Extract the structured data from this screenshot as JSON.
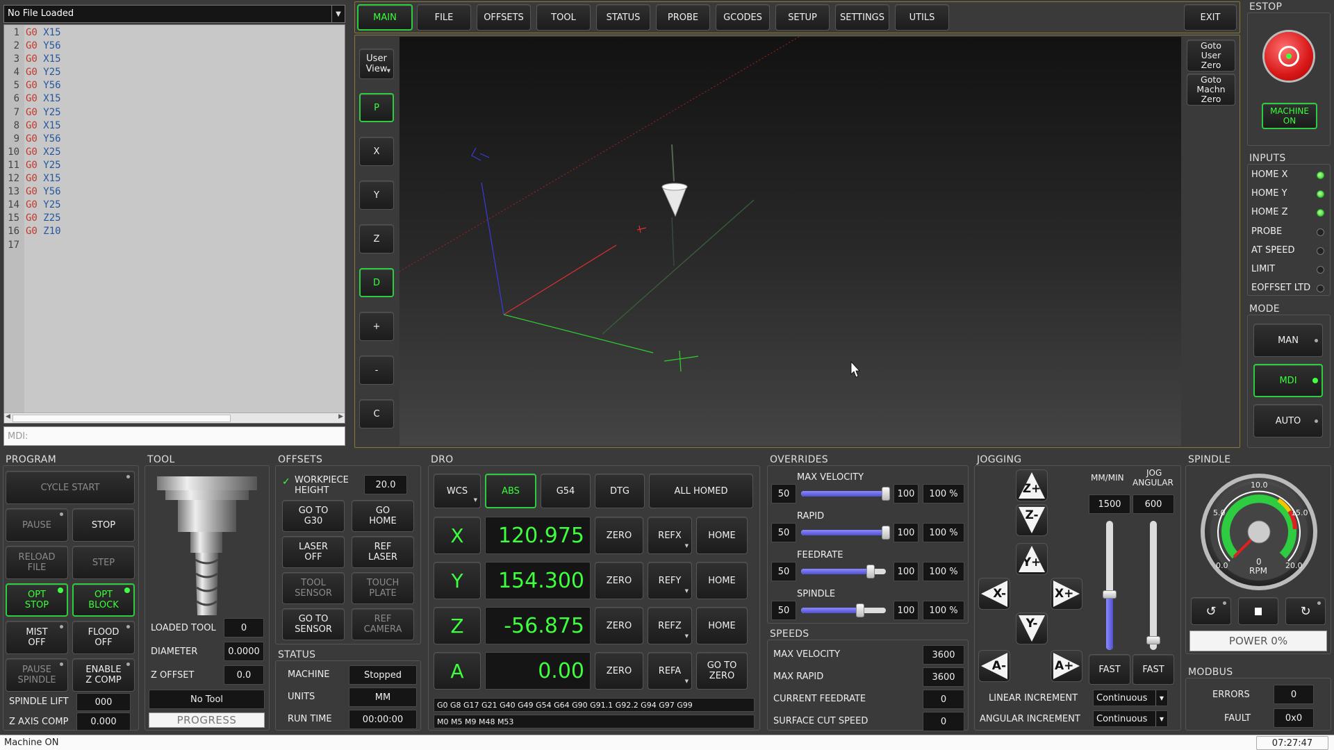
{
  "file": {
    "name": "No File Loaded"
  },
  "gcode": [
    {
      "n": "1",
      "cmd": "G0",
      "axis": "X15"
    },
    {
      "n": "2",
      "cmd": "G0",
      "axis": "Y56"
    },
    {
      "n": "3",
      "cmd": "G0",
      "axis": "X15"
    },
    {
      "n": "4",
      "cmd": "G0",
      "axis": "Y25"
    },
    {
      "n": "5",
      "cmd": "G0",
      "axis": "Y56"
    },
    {
      "n": "6",
      "cmd": "G0",
      "axis": "X15"
    },
    {
      "n": "7",
      "cmd": "G0",
      "axis": "Y25"
    },
    {
      "n": "8",
      "cmd": "G0",
      "axis": "X15"
    },
    {
      "n": "9",
      "cmd": "G0",
      "axis": "Y56"
    },
    {
      "n": "10",
      "cmd": "G0",
      "axis": "X25"
    },
    {
      "n": "11",
      "cmd": "G0",
      "axis": "Y25"
    },
    {
      "n": "12",
      "cmd": "G0",
      "axis": "X15"
    },
    {
      "n": "13",
      "cmd": "G0",
      "axis": "Y56"
    },
    {
      "n": "14",
      "cmd": "G0",
      "axis": "Y25"
    },
    {
      "n": "15",
      "cmd": "G0",
      "axis": "Z25"
    },
    {
      "n": "16",
      "cmd": "G0",
      "axis": "Z10"
    },
    {
      "n": "17",
      "cmd": "",
      "axis": ""
    }
  ],
  "mdi": {
    "placeholder": "MDI:"
  },
  "tabs": {
    "main": "MAIN",
    "file": "FILE",
    "offsets": "OFFSETS",
    "tool": "TOOL",
    "status": "STATUS",
    "probe": "PROBE",
    "gcodes": "GCODES",
    "setup": "SETUP",
    "settings": "SETTINGS",
    "utils": "UTILS",
    "exit": "EXIT"
  },
  "view": {
    "user1": "User",
    "user2": "View",
    "p": "P",
    "x": "X",
    "y": "Y",
    "z": "Z",
    "d": "D",
    "plus": "+",
    "minus": "-",
    "c": "C",
    "goto_user": [
      "Goto",
      "User",
      "Zero"
    ],
    "goto_machine": [
      "Goto",
      "Machn",
      "Zero"
    ]
  },
  "estop": {
    "title": "ESTOP",
    "machine_on": [
      "MACHINE",
      "ON"
    ]
  },
  "inputs": {
    "title": "INPUTS",
    "items": [
      {
        "label": "HOME X",
        "on": true
      },
      {
        "label": "HOME Y",
        "on": true
      },
      {
        "label": "HOME Z",
        "on": true
      },
      {
        "label": "PROBE",
        "on": false
      },
      {
        "label": "AT SPEED",
        "on": false
      },
      {
        "label": "LIMIT",
        "on": false
      },
      {
        "label": "EOFFSET LTD",
        "on": false
      }
    ]
  },
  "mode": {
    "title": "MODE",
    "man": "MAN",
    "mdi": "MDI",
    "auto": "AUTO"
  },
  "program": {
    "title": "PROGRAM",
    "cycle_start": "CYCLE START",
    "pause": "PAUSE",
    "stop": "STOP",
    "reload": [
      "RELOAD",
      "FILE"
    ],
    "step": "STEP",
    "opt_stop": [
      "OPT",
      "STOP"
    ],
    "opt_block": [
      "OPT",
      "BLOCK"
    ],
    "mist": [
      "MIST",
      "OFF"
    ],
    "flood": [
      "FLOOD",
      "OFF"
    ],
    "pause_spindle": [
      "PAUSE",
      "SPINDLE"
    ],
    "enable_zcomp": [
      "ENABLE",
      "Z COMP"
    ],
    "spindle_lift_label": "SPINDLE LIFT",
    "spindle_lift": "000",
    "zcomp_label": "Z AXIS COMP",
    "zcomp": "0.000"
  },
  "tool": {
    "title": "TOOL",
    "loaded_label": "LOADED TOOL",
    "loaded": "0",
    "diameter_label": "DIAMETER",
    "diameter": "0.0000",
    "zoffset_label": "Z OFFSET",
    "zoffset": "0.0",
    "name": "No Tool",
    "progress": "PROGRESS"
  },
  "offsets": {
    "title": "OFFSETS",
    "workpiece": [
      "WORKPIECE",
      "HEIGHT"
    ],
    "workpiece_val": "20.0",
    "goto_g30": [
      "GO TO",
      "G30"
    ],
    "go_home": [
      "GO",
      "HOME"
    ],
    "laser_off": [
      "LASER",
      "OFF"
    ],
    "ref_laser": [
      "REF",
      "LASER"
    ],
    "tool_sensor": [
      "TOOL",
      "SENSOR"
    ],
    "touch_plate": [
      "TOUCH",
      "PLATE"
    ],
    "goto_sensor": [
      "GO TO",
      "SENSOR"
    ],
    "ref_camera": [
      "REF",
      "CAMERA"
    ]
  },
  "status": {
    "title": "STATUS",
    "machine_label": "MACHINE",
    "machine": "Stopped",
    "units_label": "UNITS",
    "units": "MM",
    "runtime_label": "RUN TIME",
    "runtime": "00:00:00"
  },
  "dro": {
    "title": "DRO",
    "wcs": "WCS",
    "abs": "ABS",
    "g54": "G54",
    "dtg": "DTG",
    "all_homed": "ALL HOMED",
    "axes": [
      {
        "axis": "X",
        "value": "120.975",
        "zero": "ZERO",
        "ref": "REFX",
        "home": [
          "HOME"
        ]
      },
      {
        "axis": "Y",
        "value": "154.300",
        "zero": "ZERO",
        "ref": "REFY",
        "home": [
          "HOME"
        ]
      },
      {
        "axis": "Z",
        "value": "-56.875",
        "zero": "ZERO",
        "ref": "REFZ",
        "home": [
          "HOME"
        ]
      },
      {
        "axis": "A",
        "value": "0.00",
        "zero": "ZERO",
        "ref": "REFA",
        "home": [
          "GO TO",
          "ZERO"
        ]
      }
    ],
    "gcodes_active": "G0 G8 G17 G21 G40 G49 G54 G64 G90 G91.1 G92.2 G94 G97 G99",
    "mcodes_active": "M0 M5 M9 M48 M53"
  },
  "overrides": {
    "title": "OVERRIDES",
    "items": [
      {
        "label": "MAX VELOCITY",
        "min": "50",
        "max": "100",
        "value": "100 %",
        "level": 1.0
      },
      {
        "label": "RAPID",
        "min": "50",
        "max": "100",
        "value": "100 %",
        "level": 1.0
      },
      {
        "label": "FEEDRATE",
        "min": "50",
        "max": "100",
        "value": "100 %",
        "level": 0.82
      },
      {
        "label": "SPINDLE",
        "min": "50",
        "max": "100",
        "value": "100 %",
        "level": 0.7
      }
    ]
  },
  "speeds": {
    "title": "SPEEDS",
    "items": [
      {
        "label": "MAX VELOCITY",
        "value": "3600"
      },
      {
        "label": "MAX RAPID",
        "value": "3600"
      },
      {
        "label": "CURRENT FEEDRATE",
        "value": "0"
      },
      {
        "label": "SURFACE CUT SPEED",
        "value": "0"
      }
    ]
  },
  "jogging": {
    "title": "JOGGING",
    "mmmin": "MM/MIN",
    "jog_angular": [
      "JOG",
      "ANGULAR"
    ],
    "linear_rate": "1500",
    "angular_rate": "600",
    "zp": "Z+",
    "zm": "Z-",
    "yp": "Y+",
    "ym": "Y-",
    "xm": "X-",
    "xp": "X+",
    "am": "A-",
    "ap": "A+",
    "fast1": "FAST",
    "fast2": "FAST",
    "linear_inc_label": "LINEAR INCREMENT",
    "linear_inc": "Continuous",
    "angular_inc_label": "ANGULAR INCREMENT",
    "angular_inc": "Continuous"
  },
  "spindle": {
    "title": "SPINDLE",
    "t0": "0.0",
    "t5": "5.0",
    "t10": "10.0",
    "t15": "15.0",
    "t20": "20.0",
    "rpm_val": "0",
    "rpm": "RPM",
    "power": "POWER 0%"
  },
  "modbus": {
    "title": "MODBUS",
    "errors_label": "ERRORS",
    "errors": "0",
    "fault_label": "FAULT",
    "fault": "0x0"
  },
  "statusbar": {
    "message": "Machine ON",
    "clock": "07:27:47"
  },
  "colors": {
    "accent": "#2ecc40",
    "dro": "#3dff3d",
    "gcode_cmd": "#c0392b",
    "gcode_axis": "#2456a0"
  }
}
